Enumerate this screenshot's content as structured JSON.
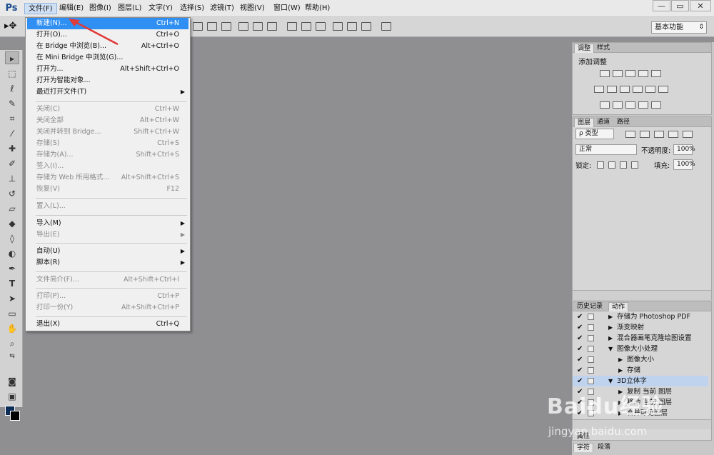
{
  "app": {
    "logo": "Ps"
  },
  "menubar": {
    "items": [
      "文件(F)",
      "编辑(E)",
      "图像(I)",
      "图层(L)",
      "文字(Y)",
      "选择(S)",
      "滤镜(T)",
      "视图(V)",
      "窗口(W)",
      "帮助(H)"
    ]
  },
  "window_controls": {
    "minimize": "—",
    "maximize": "▭",
    "close": "✕"
  },
  "options_bar": {
    "workspace": "基本功能"
  },
  "file_menu": {
    "items": [
      {
        "label": "新建(N)...",
        "shortcut": "Ctrl+N"
      },
      {
        "label": "打开(O)...",
        "shortcut": "Ctrl+O"
      },
      {
        "label": "在 Bridge 中浏览(B)...",
        "shortcut": "Alt+Ctrl+O"
      },
      {
        "label": "在 Mini Bridge 中浏览(G)...",
        "shortcut": ""
      },
      {
        "label": "打开为...",
        "shortcut": "Alt+Shift+Ctrl+O"
      },
      {
        "label": "打开为智能对象...",
        "shortcut": ""
      },
      {
        "label": "最近打开文件(T)",
        "shortcut": ""
      },
      {
        "label": "关闭(C)",
        "shortcut": "Ctrl+W"
      },
      {
        "label": "关闭全部",
        "shortcut": "Alt+Ctrl+W"
      },
      {
        "label": "关闭并转到 Bridge...",
        "shortcut": "Shift+Ctrl+W"
      },
      {
        "label": "存储(S)",
        "shortcut": "Ctrl+S"
      },
      {
        "label": "存储为(A)...",
        "shortcut": "Shift+Ctrl+S"
      },
      {
        "label": "签入(I)...",
        "shortcut": ""
      },
      {
        "label": "存储为 Web 所用格式...",
        "shortcut": "Alt+Shift+Ctrl+S"
      },
      {
        "label": "恢复(V)",
        "shortcut": "F12"
      },
      {
        "label": "置入(L)...",
        "shortcut": ""
      },
      {
        "label": "导入(M)",
        "shortcut": ""
      },
      {
        "label": "导出(E)",
        "shortcut": ""
      },
      {
        "label": "自动(U)",
        "shortcut": ""
      },
      {
        "label": "脚本(R)",
        "shortcut": ""
      },
      {
        "label": "文件简介(F)...",
        "shortcut": "Alt+Shift+Ctrl+I"
      },
      {
        "label": "打印(P)...",
        "shortcut": "Ctrl+P"
      },
      {
        "label": "打印一份(Y)",
        "shortcut": "Alt+Shift+Ctrl+P"
      },
      {
        "label": "退出(X)",
        "shortcut": "Ctrl+Q"
      }
    ],
    "submenu_arrow": "▶"
  },
  "adjustments_panel": {
    "tabs": [
      "调整",
      "样式"
    ],
    "title": "添加调整"
  },
  "layers_panel": {
    "tabs": [
      "图层",
      "通道",
      "路径"
    ],
    "filter": "ρ 类型",
    "blend_mode": "正常",
    "opacity_label": "不透明度:",
    "opacity_value": "100%",
    "lock_label": "锁定:",
    "fill_label": "填充:",
    "fill_value": "100%"
  },
  "actions_panel": {
    "tabs": [
      "历史记录",
      "动作"
    ],
    "rows": [
      {
        "label": "存储为 Photoshop PDF",
        "level": 1
      },
      {
        "label": "渐变映射",
        "level": 1
      },
      {
        "label": "混合器画笔克隆绘图设置",
        "level": 1
      },
      {
        "label": "图像大小处理",
        "level": 1
      },
      {
        "label": "图像大小",
        "level": 2
      },
      {
        "label": "存储",
        "level": 2
      },
      {
        "label": "3D立体字",
        "level": 1
      },
      {
        "label": "复制 当前 图层",
        "level": 2
      },
      {
        "label": "移动 当前 图层",
        "level": 2
      },
      {
        "label": "合并可见图层",
        "level": 2
      }
    ],
    "check": "✔"
  },
  "bottom_tabs": {
    "tabs": [
      "字符",
      "段落"
    ],
    "row": "属性"
  },
  "watermark": {
    "brand": "Baidu经验",
    "url": "jingyan.baidu.com"
  },
  "colors": {
    "highlight": "#2f8ff3",
    "canvas": "#8f8f92",
    "foreground": "#0b2d57",
    "background": "#000000"
  }
}
